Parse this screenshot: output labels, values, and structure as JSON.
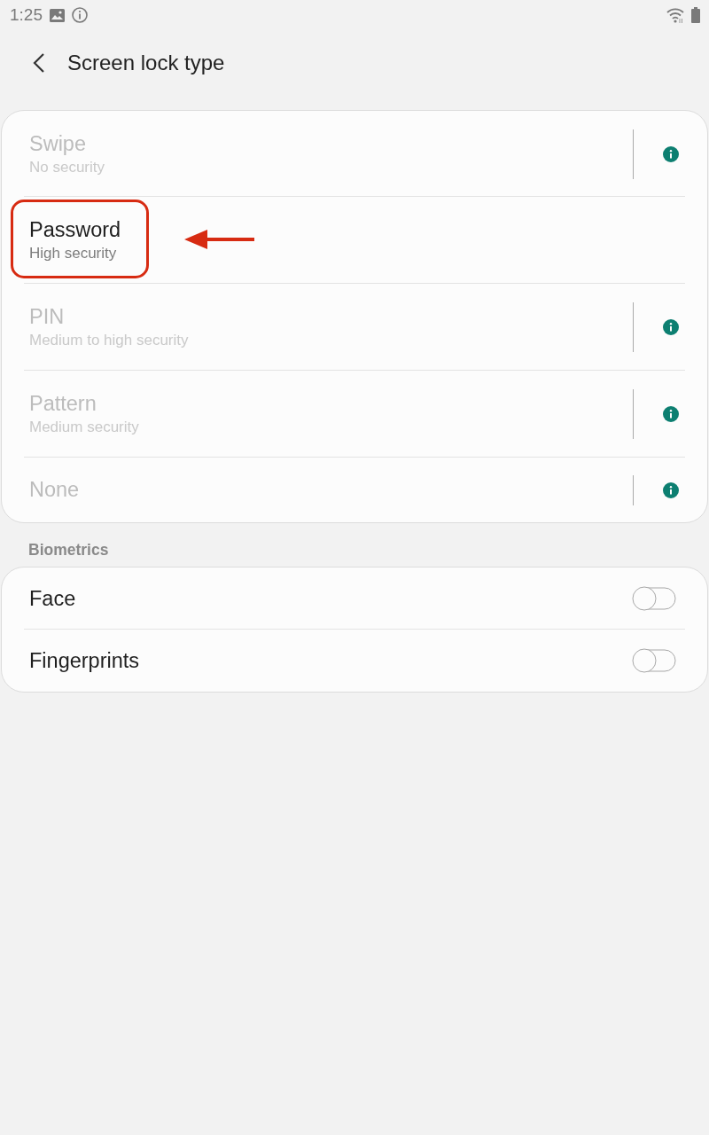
{
  "status_bar": {
    "time": "1:25"
  },
  "header": {
    "title": "Screen lock type"
  },
  "lock_types": [
    {
      "title": "Swipe",
      "subtitle": "No security",
      "disabled": true,
      "info": true,
      "highlighted": false
    },
    {
      "title": "Password",
      "subtitle": "High security",
      "disabled": false,
      "info": false,
      "highlighted": true
    },
    {
      "title": "PIN",
      "subtitle": "Medium to high security",
      "disabled": true,
      "info": true,
      "highlighted": false
    },
    {
      "title": "Pattern",
      "subtitle": "Medium security",
      "disabled": true,
      "info": true,
      "highlighted": false
    },
    {
      "title": "None",
      "disabled": true,
      "info": true,
      "highlighted": false
    }
  ],
  "biometrics": {
    "heading": "Biometrics",
    "items": [
      {
        "label": "Face",
        "on": false
      },
      {
        "label": "Fingerprints",
        "on": false
      }
    ]
  }
}
